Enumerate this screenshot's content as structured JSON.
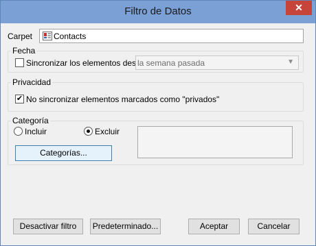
{
  "window": {
    "title": "Filtro de Datos",
    "close_glyph": "✕"
  },
  "folder": {
    "label": "Carpet",
    "value": "Contacts",
    "icon": "contacts-icon"
  },
  "fecha": {
    "group_label": "Fecha",
    "checkbox_label": "Sincronizar los elementos desde",
    "checked": false,
    "select_value": "la semana pasada"
  },
  "privacidad": {
    "group_label": "Privacidad",
    "checkbox_label": "No sincronizar elementos marcados como \"privados\"",
    "checked": true,
    "check_glyph": "✔"
  },
  "categoria": {
    "group_label": "Categoría",
    "include_label": "Incluir",
    "exclude_label": "Excluir",
    "selected": "exclude",
    "button_label": "Categorías..."
  },
  "footer": {
    "deactivate_label": "Desactivar filtro",
    "default_label": "Predeterminado...",
    "accept_label": "Aceptar",
    "cancel_label": "Cancelar"
  }
}
